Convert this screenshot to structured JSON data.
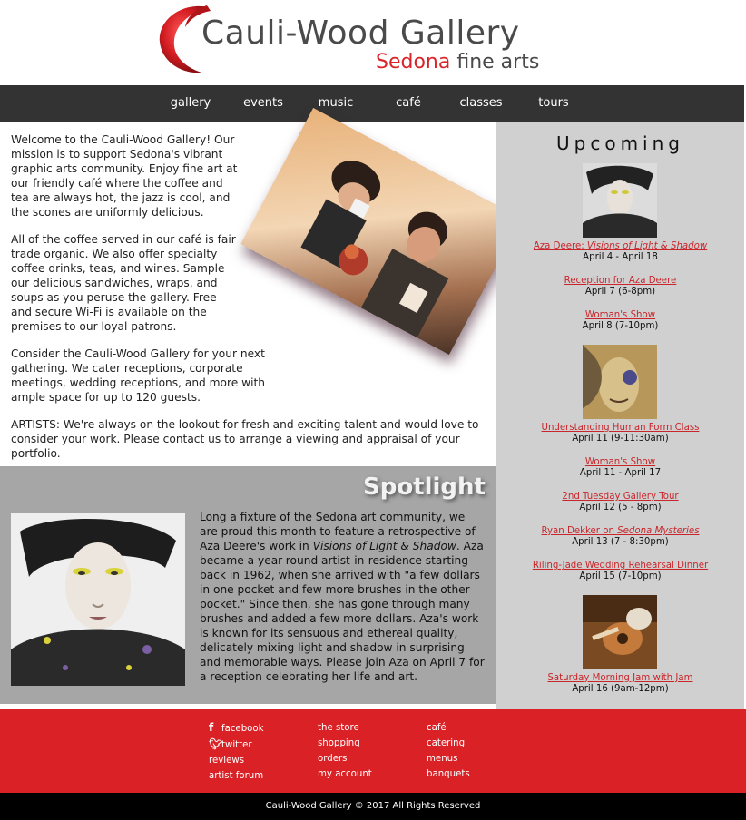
{
  "brand": {
    "title": "Cauli-Wood Gallery",
    "subtitle_accent": "Sedona",
    "subtitle_rest": " fine arts",
    "accent_color": "#d9252a"
  },
  "nav": {
    "items": [
      "gallery",
      "events",
      "music",
      "café",
      "classes",
      "tours"
    ]
  },
  "intro": {
    "p1": "Welcome to the Cauli-Wood Gallery! Our mission is to support Sedona's vibrant graphic arts community. Enjoy fine art at our friendly café where the coffee and tea are always hot, the jazz is cool, and the scones are uniformly delicious.",
    "p2": "All of the coffee served in our café is fair trade organic. We also offer specialty coffee drinks, teas, and wines. Sample our delicious sandwiches, wraps, and soups as you peruse the gallery. Free and secure Wi-Fi is available on the premises to our loyal patrons.",
    "p3": "Consider the Cauli-Wood Gallery for your next gathering. We cater receptions, corporate meetings, wedding receptions, and more with ample space for up to 120 guests.",
    "p4": "ARTISTS: We're always on the lookout for fresh and exciting talent and would love to consider your work. Please contact us to arrange a viewing and appraisal of your portfolio."
  },
  "spotlight": {
    "title": "Spotlight",
    "text_a": "Long a fixture of the Sedona art community, we are proud this month to feature a retrospective of Aza Deere's work in ",
    "text_italic": "Visions of Light & Shadow",
    "text_b": ". Aza became a year-round artist-in-residence starting back in 1962, when she arrived with \"a few dollars in one pocket and few more brushes in the other pocket.\" Since then, she has gone through many brushes and added a few more dollars. Aza's work is known for its sensuous and ethereal quality, delicately mixing light and shadow in surprising and memorable ways. Please join Aza on April 7 for a reception celebrating her life and art."
  },
  "upcoming": {
    "title": "Upcoming",
    "events": [
      {
        "title_a": "Aza Deere: ",
        "title_italic": "Visions of Light & Shadow",
        "date": "April 4 - April 18"
      },
      {
        "title": "Reception for Aza Deere",
        "date": "April 7 (6-8pm)"
      },
      {
        "title": "Woman's Show",
        "date": "April 8 (7-10pm)"
      },
      {
        "title": "Understanding Human Form Class",
        "date": "April 11 (9-11:30am)"
      },
      {
        "title": "Woman's Show",
        "date": "April 11 - April 17"
      },
      {
        "title": "2nd Tuesday Gallery Tour",
        "date": "April 12 (5 - 8pm)"
      },
      {
        "title_a": "Ryan Dekker on ",
        "title_italic": "Sedona Mysteries",
        "date": "April 13 (7 - 8:30pm)"
      },
      {
        "title": "Riling-Jade Wedding Rehearsal Dinner",
        "date": "April 15 (7-10pm)"
      },
      {
        "title": "Saturday Morning Jam with Jam",
        "date": "April 16 (9am-12pm)"
      }
    ]
  },
  "footer": {
    "col1": [
      "facebook",
      "twitter",
      "reviews",
      "artist forum"
    ],
    "col2": [
      "the store",
      "shopping",
      "orders",
      "my account"
    ],
    "col3": [
      "café",
      "catering",
      "menus",
      "banquets"
    ],
    "icons": {
      "facebook": "facebook-icon",
      "twitter": "twitter-icon"
    },
    "copyright": "Cauli-Wood Gallery © 2017 All Rights Reserved",
    "footer_color": "#da2226"
  }
}
